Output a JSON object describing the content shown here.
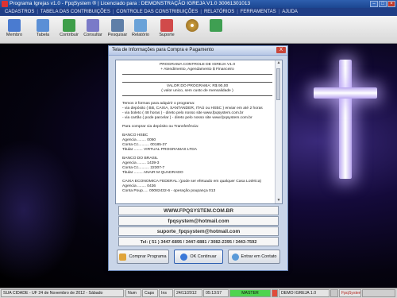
{
  "window": {
    "title": "Programa Igrejas v1.0 - FpqSystem ® | Licenciado para : DEMONSTRAÇÃO IGREJA V1.0 30061301013"
  },
  "menu": [
    "CADASTROS",
    "TABELA DAS CONTRIBUIÇÕES",
    "CONTROLE DAS CONSTRIBUIÇÕES",
    "RELATÓRIOS",
    "FERRAMENTAS",
    "AJUDA"
  ],
  "toolbar": [
    {
      "label": "Membro",
      "icon": "people-icon",
      "color": "#4a7bd0"
    },
    {
      "label": "Tabela",
      "icon": "table-icon",
      "color": "#5a8fd6"
    },
    {
      "label": "Contribuir",
      "icon": "money-icon",
      "color": "#3e9e4a"
    },
    {
      "label": "Consultar",
      "icon": "search-icon",
      "color": "#7a7ac8"
    },
    {
      "label": "Pesquisar",
      "icon": "magnifier-icon",
      "color": "#5f7fa8"
    },
    {
      "label": "Relatório",
      "icon": "report-icon",
      "color": "#6aa2d8"
    },
    {
      "label": "Suporte",
      "icon": "support-icon",
      "color": "#d14a4a"
    },
    {
      "label": "",
      "icon": "cd-icon",
      "color": "#c89a3a"
    },
    {
      "label": "",
      "icon": "exit-icon",
      "color": "#3f9f52"
    }
  ],
  "dialog": {
    "title": "Tela de Informações para Compra e Pagamento",
    "close": "X",
    "body": {
      "header_title": "PROGRAMA CONTROLE DE IGREJA V1.0",
      "header_sub": "+ Atendimento, Agendamento $ Financeiro",
      "price": "VALOR DO PROGRAMA: R$  90,00",
      "price_note": "( valor unico, sem custo de mensalidade )",
      "forms_intro": "Temos 3 formas para adquirir o programa:",
      "form1": "- via depósito ( BB, CAIXA, SANTANDER, ITAÚ ou HSBC ) enviar em até 2 horas",
      "form2": "- via boleto ( 48 horas ) - direto pelo nosso site www.fpqsystem.com.br",
      "form3": "- via cartão ( pode parcelar ) - direto pelo nosso site www.fpqsystem.com.br",
      "deposit_intro": "Para comprar via depósito ou Transferência:",
      "bank1": "BANCO HSBC",
      "bank1_ag": "Agencia ........ 0050",
      "bank1_cc": "Conta Cc.......... 00185-37",
      "bank1_tit": "Titular ........ VIRTUAL PROGRAMAS LTDA",
      "bank2": "BANCO DO BRASIL",
      "bank2_ag": "Agencia ........ 1439-3",
      "bank2_cc": "Conta Cc.......... 22307-7",
      "bank2_tit": "Titular ........ ANAIR M QUADRADO",
      "bank3": "CAIXA ECONOMICA FEDERAL: (pode ser efetuado em qualquer Casa Lotérica)",
      "bank3_ag": "Agencia ........ 0436",
      "bank3_cp": "Conta Poup..... 00082432-6 - operação poupança 013"
    },
    "fields": {
      "site": "WWW.FPQSYSTEM.COM.BR",
      "email1": "fpqsystem@hotmail.com",
      "email2": "suporte_fpqsystem@hotmail.com",
      "phones": "Tel: ( 51 ) 3447-6895 / 3447-6881 / 3082-2395 / 3443-7592"
    },
    "buttons": {
      "buy": "Comprar Programa",
      "ok": "OK Continuar",
      "contact": "Entrar em Contato"
    }
  },
  "statusbar": {
    "location_date": "SUA CIDADE - UF 24 de Novembro de 2012 - Sábado",
    "num": "Num",
    "caps": "Caps",
    "scrl": "Ins",
    "date": "24/11/2012",
    "time": "05:13:57",
    "user": "MASTER",
    "version": "DEMO IGREJA 1.0",
    "brand": "FpqSystem"
  },
  "colors": {
    "titlebar": "#2e5fae",
    "menubar": "#1f3e86",
    "dialog_bg": "#c9d5e8",
    "cross": "#ffffff",
    "status_user_bg": "#4fd44f"
  }
}
